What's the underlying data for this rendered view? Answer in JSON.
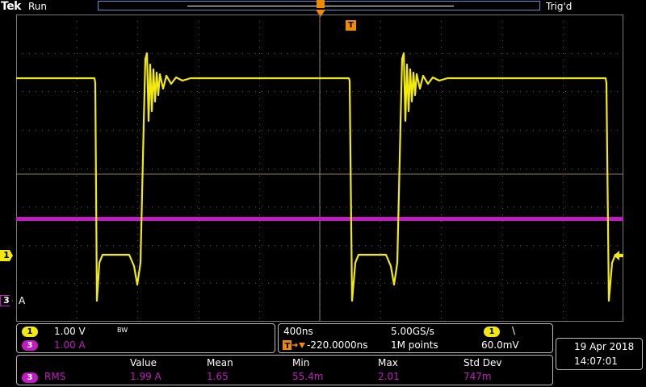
{
  "topbar": {
    "brand": "Tek",
    "run_state": "Run",
    "trigger_status": "Trig'd"
  },
  "markers": {
    "ch1": "1",
    "ch3": "3",
    "ch3_label": "A",
    "trigger_tag": "T"
  },
  "channels": [
    {
      "badge": "1",
      "scale": "1.00 V",
      "bw": "BW",
      "color": "#f2ea0e"
    },
    {
      "badge": "3",
      "scale": "1.00 A",
      "color": "#c11cc1"
    }
  ],
  "horizontal": {
    "scale": "400ns",
    "sample_rate": "5.00GS/s",
    "position": "-220.0000ns",
    "record_length": "1M points"
  },
  "trigger": {
    "source_badge": "1",
    "slope_glyph": "\\",
    "level": "60.0mV"
  },
  "datetime": {
    "date": "19 Apr  2018",
    "time": "14:07:01"
  },
  "measurement": {
    "source_badge": "3",
    "headers": [
      "Value",
      "Mean",
      "Min",
      "Max",
      "Std Dev"
    ],
    "name": "RMS",
    "values": [
      "1.99 A",
      "1.65",
      "55.4m",
      "2.01",
      "747m"
    ]
  },
  "colors": {
    "ch1": "#f2ea0e",
    "ch3": "#c11cc1",
    "grid": "#7a7a7a",
    "frame": "#5a8fd0"
  }
}
